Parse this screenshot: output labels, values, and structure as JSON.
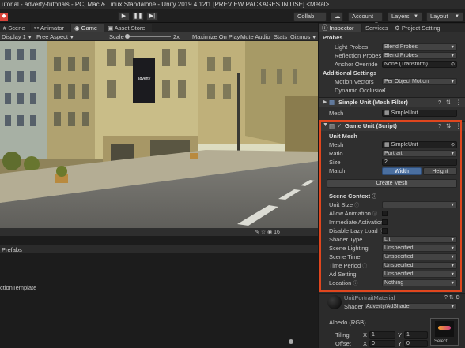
{
  "window": {
    "title": "utorial - adverty-tutorials - PC, Mac & Linux Standalone - Unity 2019.4.12f1 [PREVIEW PACKAGES IN USE] <Metal>"
  },
  "toolbar": {
    "collab_label": "Collab",
    "account_label": "Account",
    "layers_label": "Layers",
    "layout_label": "Layout"
  },
  "tabs": {
    "scene": "Scene",
    "animator": "Animator",
    "game": "Game",
    "asset_store": "Asset Store",
    "inspector": "Inspector",
    "services": "Services",
    "project_settings": "Project Setting"
  },
  "game_bar": {
    "display": "Display 1",
    "aspect": "Free Aspect",
    "scale_label": "Scale",
    "scale_value": "2x",
    "maximize": "Maximize On Play",
    "mute": "Mute Audio",
    "stats": "Stats",
    "gizmos": "Gizmos"
  },
  "scene_image": {
    "billboard_brand": "adverty"
  },
  "lower": {
    "prefabs_label": "Prefabs",
    "item_text": "ctionTemplate",
    "count": "16"
  },
  "inspector": {
    "probes_header": "Probes",
    "light_probes_label": "Light Probes",
    "light_probes_value": "Blend Probes",
    "reflection_probes_label": "Reflection Probes",
    "reflection_probes_value": "Blend Probes",
    "anchor_override_label": "Anchor Override",
    "anchor_override_value": "None (Transform)",
    "additional_header": "Additional Settings",
    "motion_vectors_label": "Motion Vectors",
    "motion_vectors_value": "Per Object Motion",
    "dynamic_occlusion_label": "Dynamic Occlusion",
    "mesh_filter_title": "Simple Unit (Mesh Filter)",
    "mesh_filter_mesh_label": "Mesh",
    "mesh_filter_mesh_value": "SimpleUnit",
    "script_title": "Game Unit (Script)",
    "unit_mesh_header": "Unit Mesh",
    "mesh_label": "Mesh",
    "mesh_value": "SimpleUnit",
    "ratio_label": "Ratio",
    "ratio_value": "Portrait",
    "size_label": "Size",
    "size_value": "2",
    "match_label": "Match",
    "width_button": "Width",
    "height_button": "Height",
    "create_mesh_button": "Create Mesh",
    "scene_context_header": "Scene Context",
    "unit_size_label": "Unit Size",
    "allow_animation_label": "Allow Animation",
    "immediate_activation_label": "Immediate Activation",
    "disable_lazy_load_label": "Disable Lazy Load",
    "shader_type_label": "Shader Type",
    "shader_type_value": "Lit",
    "scene_lighting_label": "Scene Lighting",
    "scene_lighting_value": "Unspecified",
    "scene_time_label": "Scene Time",
    "scene_time_value": "Unspecified",
    "time_period_label": "Time Period",
    "time_period_value": "Unspecified",
    "ad_setting_label": "Ad Setting",
    "ad_setting_value": "Unspecified",
    "location_label": "Location",
    "location_value": "Nothing",
    "material_name": "UnitPortraitMaterial",
    "shader_label": "Shader",
    "shader_value": "Adverty/AdShader",
    "albedo_label": "Albedo (RGB)",
    "tiling_label": "Tiling",
    "offset_label": "Offset",
    "tiling_x": "1",
    "tiling_y": "1",
    "offset_x": "0",
    "offset_y": "0",
    "x_label": "X",
    "y_label": "Y",
    "select_label": "Select"
  },
  "colors": {
    "highlight": "#e0461e",
    "selected_button": "#4a6fa0",
    "unity_logo": "#d9443a"
  }
}
